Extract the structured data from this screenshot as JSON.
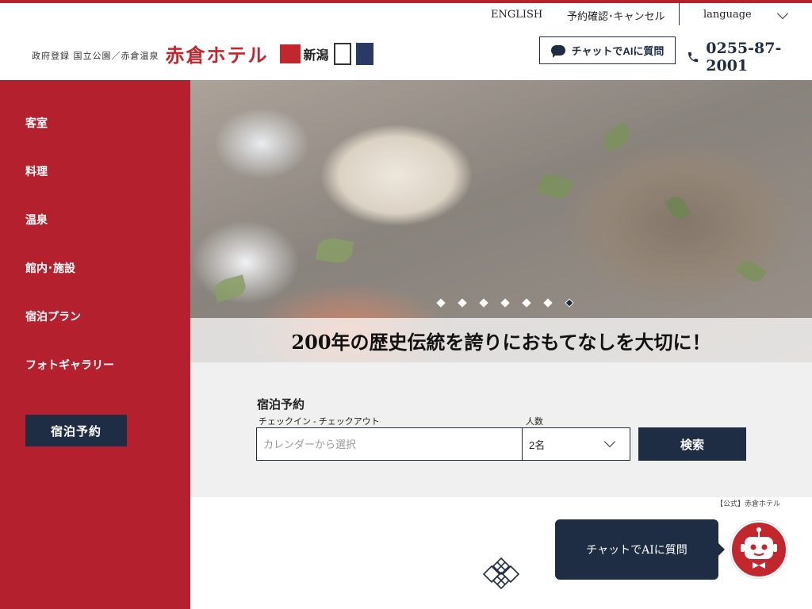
{
  "header": {
    "topnav": {
      "english": "ENGLISH",
      "reservation_check": "予約確認･キャンセル",
      "language": "language"
    },
    "logo": {
      "subtitle": "政府登録 国立公園／赤倉温泉",
      "name": "赤倉ホテル",
      "badge_niigata": "新潟"
    },
    "chat_button": "チャットでAIに質問",
    "phone": "0255-87-2001"
  },
  "sidebar": {
    "items": [
      {
        "label": "客室"
      },
      {
        "label": "料理"
      },
      {
        "label": "温泉"
      },
      {
        "label": "館内･施設"
      },
      {
        "label": "宿泊プラン"
      },
      {
        "label": "フォトギャラリー"
      }
    ],
    "book_button": "宿泊予約"
  },
  "hero": {
    "tagline": "200年の歴史伝統を誇りにおもてなしを大切に！",
    "slide_count": 7,
    "active_slide": 7
  },
  "booking": {
    "title": "宿泊予約",
    "date_label": "チェックイン - チェックアウト",
    "date_placeholder": "カレンダーから選択",
    "people_label": "人数",
    "people_value": "2名",
    "search_button": "検索"
  },
  "credit": "【公式】赤倉ホテル",
  "chat_float": "チャットでAIに質問",
  "colors": {
    "brand_red": "#b5202e",
    "navy": "#1f2d44"
  }
}
